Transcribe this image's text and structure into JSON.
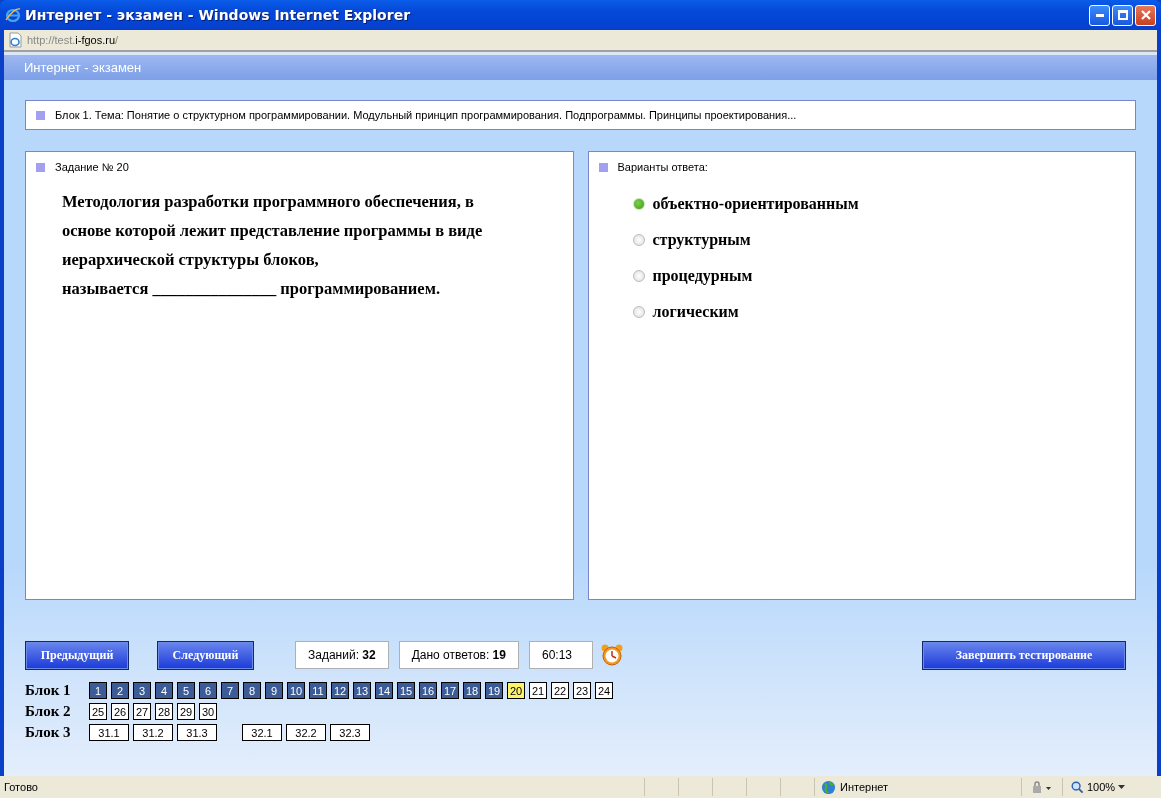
{
  "window": {
    "title": "Интернет - экзамен - Windows Internet Explorer",
    "address_dim": "http://test.",
    "address_host": "i-fgos.ru",
    "address_tail": "/"
  },
  "app": {
    "title": "Интернет - экзамен"
  },
  "topic": "Блок 1. Тема: Понятие о структурном программировании. Модульный принцип программирования. Подпрограммы. Принципы проектирования...",
  "task": {
    "heading": "Задание № 20",
    "text": "Методология разработки программного обеспечения, в\nоснове которой лежит представление программы в виде\nиерархической структуры блоков,\nназывается _______________ программированием."
  },
  "answers": {
    "heading": "Варианты ответа:",
    "options": [
      {
        "label": "объектно-ориентированным",
        "selected": true
      },
      {
        "label": "структурным",
        "selected": false
      },
      {
        "label": "процедурным",
        "selected": false
      },
      {
        "label": "логическим",
        "selected": false
      }
    ]
  },
  "controls": {
    "prev": "Предыдущий",
    "next": "Следующий",
    "tasks_label": "Заданий:",
    "tasks_value": "32",
    "answered_label": "Дано ответов:",
    "answered_value": "19",
    "timer": "60:13",
    "finish": "Завершить тестирование"
  },
  "blocks": [
    {
      "label": "Блок 1",
      "kind": "narrow",
      "groups": [
        [
          {
            "label": "1",
            "answered": true,
            "selected": false
          },
          {
            "label": "2",
            "answered": true,
            "selected": false
          },
          {
            "label": "3",
            "answered": true,
            "selected": false
          },
          {
            "label": "4",
            "answered": true,
            "selected": false
          },
          {
            "label": "5",
            "answered": true,
            "selected": false
          },
          {
            "label": "6",
            "answered": true,
            "selected": false
          },
          {
            "label": "7",
            "answered": true,
            "selected": false
          },
          {
            "label": "8",
            "answered": true,
            "selected": false
          },
          {
            "label": "9",
            "answered": true,
            "selected": false
          },
          {
            "label": "10",
            "answered": true,
            "selected": false
          },
          {
            "label": "11",
            "answered": true,
            "selected": false
          },
          {
            "label": "12",
            "answered": true,
            "selected": false
          },
          {
            "label": "13",
            "answered": true,
            "selected": false
          },
          {
            "label": "14",
            "answered": true,
            "selected": false
          },
          {
            "label": "15",
            "answered": true,
            "selected": false
          },
          {
            "label": "16",
            "answered": true,
            "selected": false
          },
          {
            "label": "17",
            "answered": true,
            "selected": false
          },
          {
            "label": "18",
            "answered": true,
            "selected": false
          },
          {
            "label": "19",
            "answered": true,
            "selected": false
          },
          {
            "label": "20",
            "answered": false,
            "selected": true
          },
          {
            "label": "21",
            "answered": false,
            "selected": false
          },
          {
            "label": "22",
            "answered": false,
            "selected": false
          },
          {
            "label": "23",
            "answered": false,
            "selected": false
          },
          {
            "label": "24",
            "answered": false,
            "selected": false
          }
        ]
      ]
    },
    {
      "label": "Блок 2",
      "kind": "narrow",
      "groups": [
        [
          {
            "label": "25",
            "answered": false,
            "selected": false
          },
          {
            "label": "26",
            "answered": false,
            "selected": false
          },
          {
            "label": "27",
            "answered": false,
            "selected": false
          },
          {
            "label": "28",
            "answered": false,
            "selected": false
          },
          {
            "label": "29",
            "answered": false,
            "selected": false
          },
          {
            "label": "30",
            "answered": false,
            "selected": false
          }
        ]
      ]
    },
    {
      "label": "Блок 3",
      "kind": "wide",
      "groups": [
        [
          {
            "label": "31.1",
            "answered": false,
            "selected": false
          },
          {
            "label": "31.2",
            "answered": false,
            "selected": false
          },
          {
            "label": "31.3",
            "answered": false,
            "selected": false
          }
        ],
        [
          {
            "label": "32.1",
            "answered": false,
            "selected": false
          },
          {
            "label": "32.2",
            "answered": false,
            "selected": false
          },
          {
            "label": "32.3",
            "answered": false,
            "selected": false
          }
        ]
      ]
    }
  ],
  "status_bar": {
    "text": "Готово",
    "zone": "Интернет",
    "zoom": "100%"
  }
}
